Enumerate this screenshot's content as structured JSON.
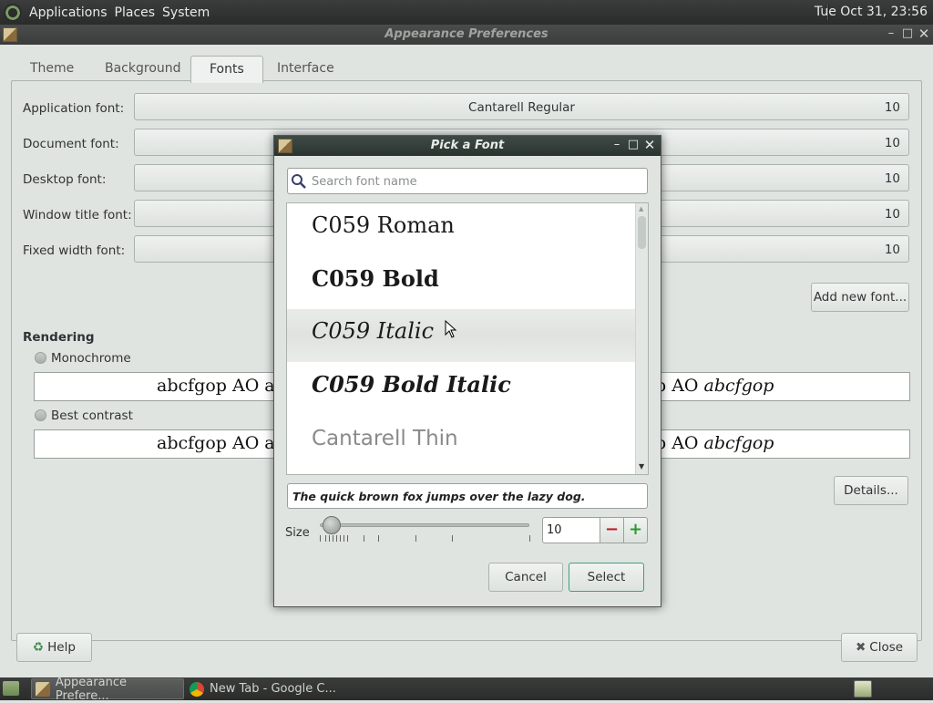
{
  "top_panel": {
    "menus": [
      "Applications",
      "Places",
      "System"
    ],
    "clock": "Tue Oct 31, 23:56"
  },
  "main_window": {
    "title": "Appearance Preferences",
    "tabs": [
      {
        "label": "Theme"
      },
      {
        "label": "Background"
      },
      {
        "label": "Fonts"
      },
      {
        "label": "Interface"
      }
    ],
    "active_tab": "Fonts",
    "font_rows": [
      {
        "label": "Application font:",
        "font": "Cantarell Regular",
        "size": "10"
      },
      {
        "label": "Document font:",
        "font": "",
        "size": "10"
      },
      {
        "label": "Desktop font:",
        "font": "",
        "size": "10"
      },
      {
        "label": "Window title font:",
        "font": "",
        "size": "10"
      },
      {
        "label": "Fixed width font:",
        "font": "",
        "size": "10"
      }
    ],
    "add_font_label": "Add new font...",
    "rendering": {
      "title": "Rendering",
      "options": [
        {
          "label": "Monochrome",
          "preview_left": "abcfgop AO a",
          "preview_right_plain": "p AO ",
          "preview_right_italic": "abcfgop"
        },
        {
          "label": "Best contrast",
          "preview_left": "abcfgop AO a",
          "preview_right_plain": "p AO ",
          "preview_right_italic": "abcfgop"
        }
      ]
    },
    "details_label": "Details...",
    "help_label": "Help",
    "close_label": "Close"
  },
  "dialog": {
    "title": "Pick a Font",
    "search_placeholder": "Search font name",
    "fonts": [
      {
        "name": "C059 Roman",
        "weight": "normal",
        "style": "normal"
      },
      {
        "name": "C059 Bold",
        "weight": "bold",
        "style": "normal"
      },
      {
        "name": "C059 Italic",
        "weight": "normal",
        "style": "italic"
      },
      {
        "name": "C059 Bold Italic",
        "weight": "bold",
        "style": "italic"
      },
      {
        "name": "Cantarell Thin",
        "weight": "normal",
        "style": "normal"
      }
    ],
    "highlighted_font": "C059 Italic",
    "preview_text": "The quick brown fox jumps over the lazy dog.",
    "size_label": "Size",
    "size_value": "10",
    "cancel_label": "Cancel",
    "select_label": "Select"
  },
  "taskbar": {
    "tasks": [
      {
        "label": "Appearance Prefere..."
      },
      {
        "label": "New Tab - Google C..."
      }
    ]
  },
  "colors": {
    "accent_select_border": "#3f9f7f",
    "minus": "#c01c28",
    "plus": "#2e9a2e"
  }
}
